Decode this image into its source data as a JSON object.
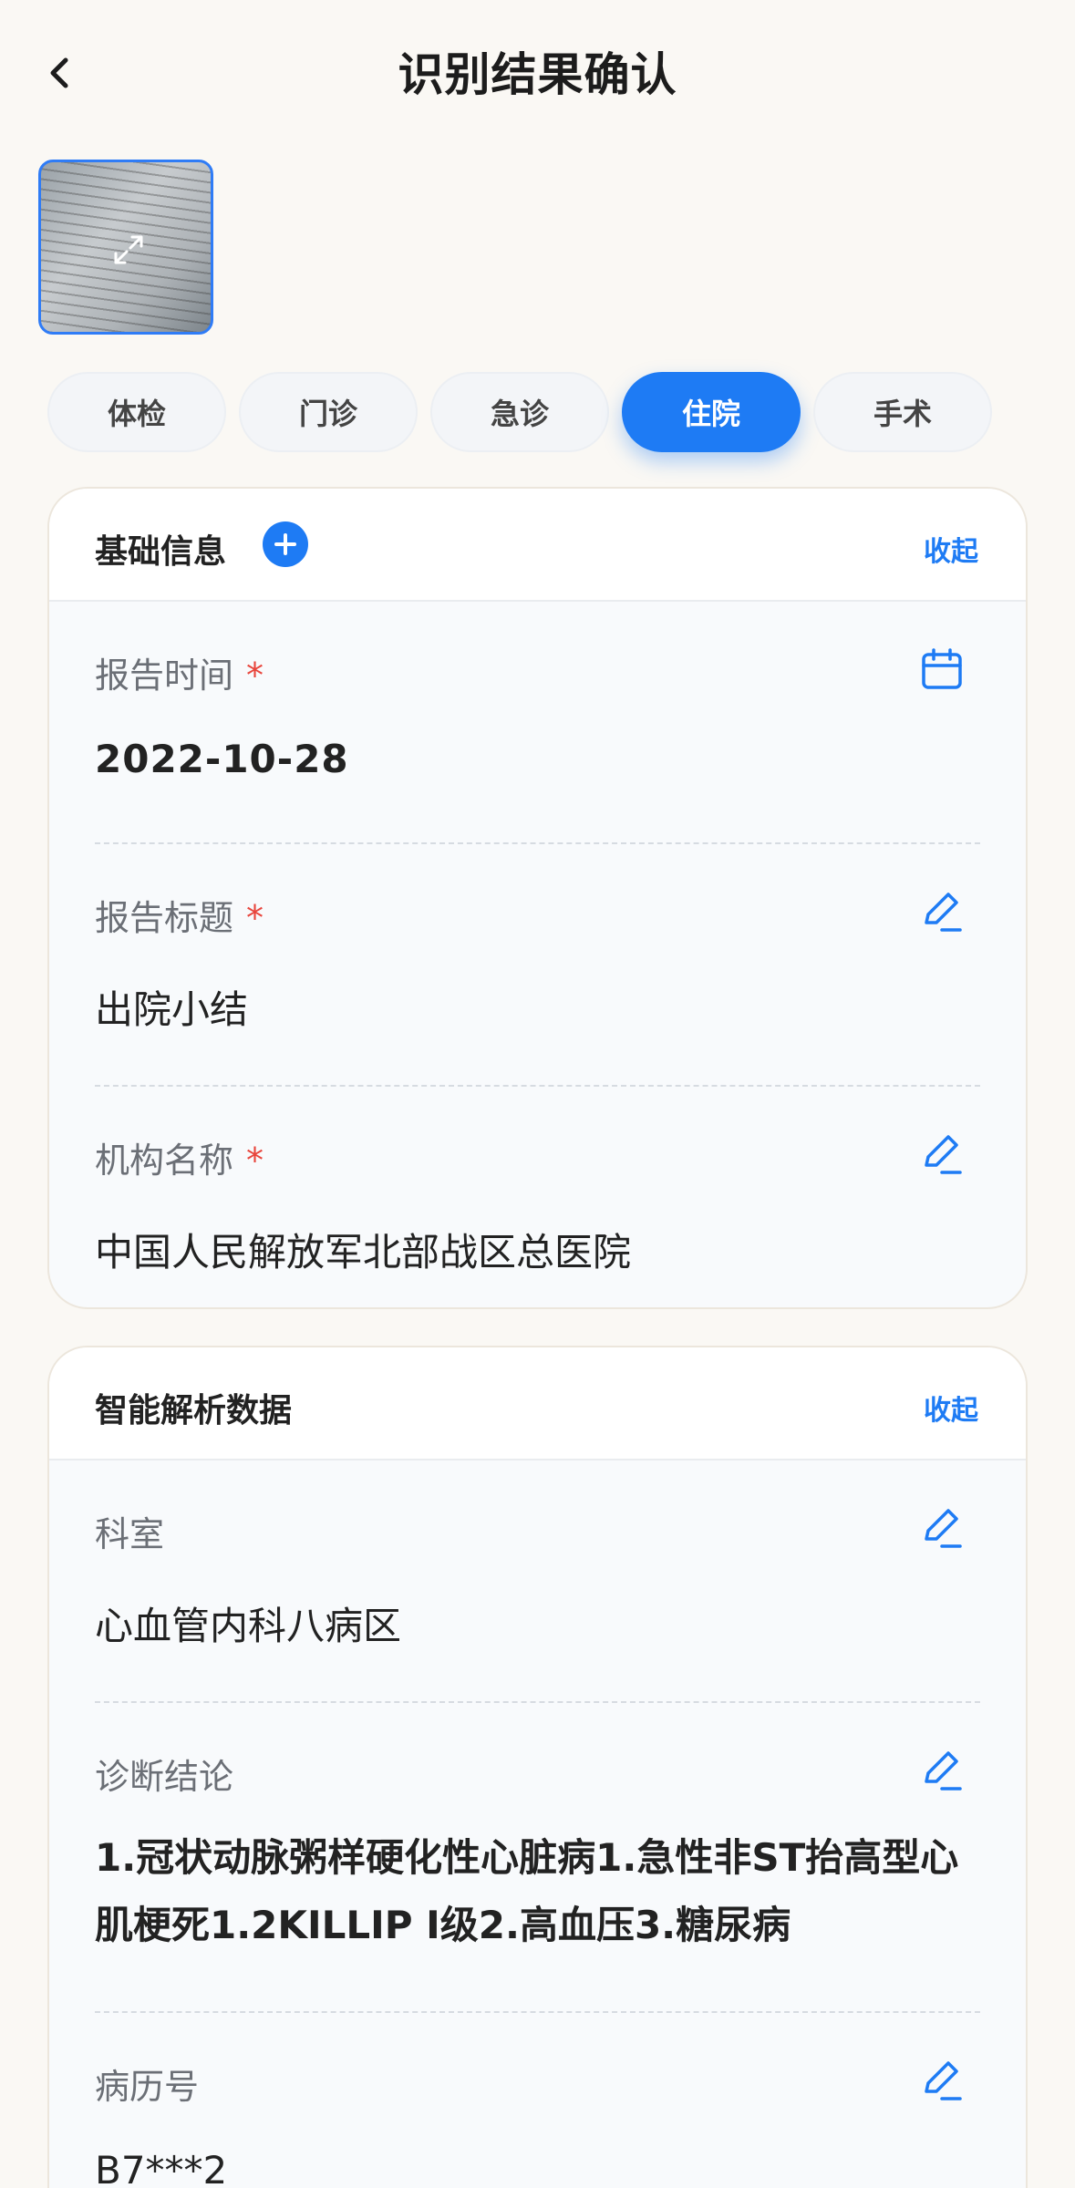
{
  "header": {
    "title": "识别结果确认",
    "back_icon": "chevron-left-icon"
  },
  "thumbnail": {
    "icon": "expand-icon",
    "accent": "#2f7cf6"
  },
  "tabs": [
    {
      "label": "体检",
      "active": false
    },
    {
      "label": "门诊",
      "active": false
    },
    {
      "label": "急诊",
      "active": false
    },
    {
      "label": "住院",
      "active": true
    },
    {
      "label": "手术",
      "active": false
    }
  ],
  "basic_info": {
    "title": "基础信息",
    "collapse_label": "收起",
    "fields": [
      {
        "label": "报告时间",
        "required": "*",
        "value": "2022-10-28",
        "icon": "calendar-icon"
      },
      {
        "label": "报告标题",
        "required": "*",
        "value": "出院小结",
        "icon": "edit-icon"
      },
      {
        "label": "机构名称",
        "required": "*",
        "value": "中国人民解放军北部战区总医院",
        "icon": "edit-icon"
      }
    ]
  },
  "smart_data": {
    "title": "智能解析数据",
    "collapse_label": "收起",
    "fields": [
      {
        "label": "科室",
        "value": "心血管内科八病区",
        "icon": "edit-icon"
      },
      {
        "label": "诊断结论",
        "value": "1.冠状动脉粥样硬化性心脏病1.急性非ST抬高型心肌梗死1.2KILLIP I级2.高血压3.糖尿病",
        "icon": "edit-icon"
      },
      {
        "label": "病历号",
        "value": "B7***2",
        "icon": "edit-icon"
      }
    ]
  },
  "colors": {
    "accent": "#1e7bf4",
    "required": "#e8453c",
    "background": "#faf8f4"
  }
}
